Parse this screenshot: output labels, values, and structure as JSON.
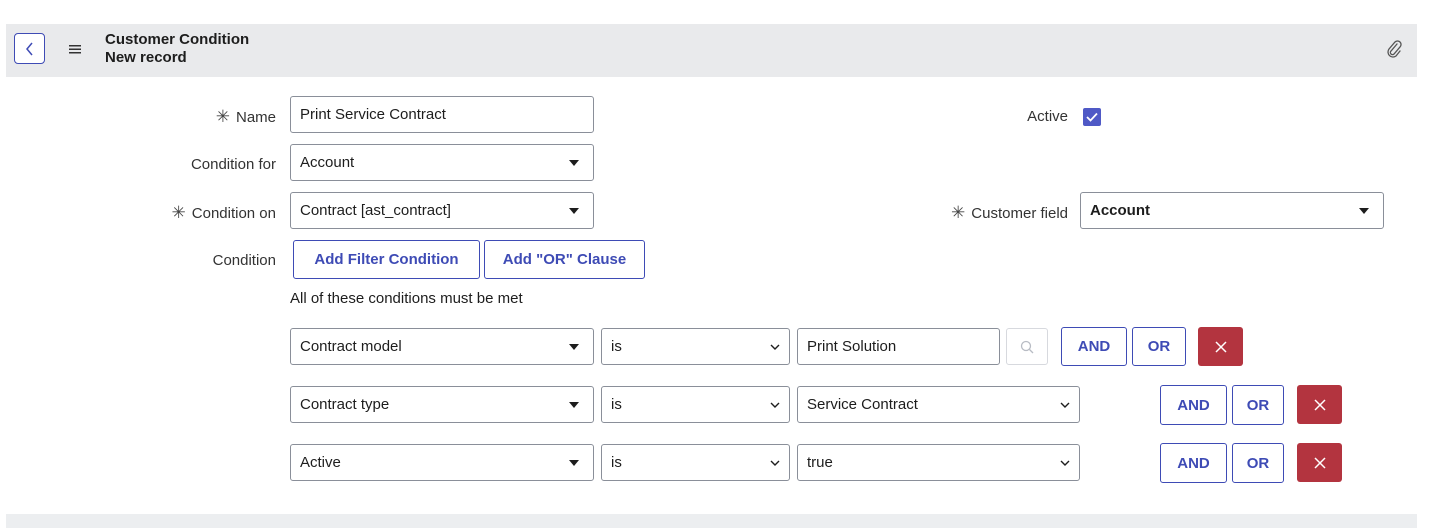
{
  "header": {
    "title": "Customer Condition",
    "subtitle": "New record",
    "icons": [
      "back-chevron-icon",
      "hamburger-menu-icon",
      "paperclip-icon"
    ]
  },
  "form": {
    "name": {
      "label": "Name",
      "value": "Print Service Contract",
      "required": true
    },
    "active": {
      "label": "Active",
      "checked": true
    },
    "condition_for": {
      "label": "Condition for",
      "value": "Account"
    },
    "condition_on": {
      "label": "Condition on",
      "value": "Contract [ast_contract]",
      "required": true
    },
    "customer_field": {
      "label": "Customer field",
      "value": "Account",
      "required": true
    },
    "condition": {
      "label": "Condition",
      "add_filter_label": "Add Filter Condition",
      "add_or_label": "Add \"OR\" Clause",
      "hint": "All of these conditions must be met",
      "rows": [
        {
          "field": "Contract model",
          "operator": "is",
          "value": "Print Solution",
          "value_type": "reference",
          "and_label": "AND",
          "or_label": "OR"
        },
        {
          "field": "Contract type",
          "operator": "is",
          "value": "Service Contract",
          "value_type": "choice",
          "and_label": "AND",
          "or_label": "OR"
        },
        {
          "field": "Active",
          "operator": "is",
          "value": "true",
          "value_type": "choice",
          "and_label": "AND",
          "or_label": "OR"
        }
      ]
    }
  },
  "colors": {
    "accent": "#3e4bb5",
    "delete": "#b3343f",
    "checkbox": "#4f59c6",
    "header_bg": "#e9eaec"
  }
}
